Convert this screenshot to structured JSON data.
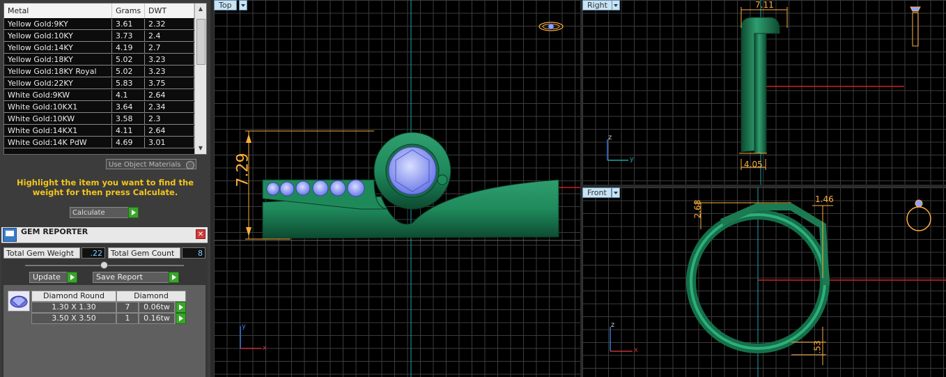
{
  "metal_table": {
    "headers": [
      "Metal",
      "Grams",
      "DWT"
    ],
    "rows": [
      {
        "metal": "Yellow Gold:9KY",
        "grams": "3.61",
        "dwt": "2.32"
      },
      {
        "metal": "Yellow Gold:10KY",
        "grams": "3.73",
        "dwt": "2.4"
      },
      {
        "metal": "Yellow Gold:14KY",
        "grams": "4.19",
        "dwt": "2.7"
      },
      {
        "metal": "Yellow Gold:18KY",
        "grams": "5.02",
        "dwt": "3.23"
      },
      {
        "metal": "Yellow Gold:18KY Royal",
        "grams": "5.02",
        "dwt": "3.23"
      },
      {
        "metal": "Yellow Gold:22KY",
        "grams": "5.83",
        "dwt": "3.75"
      },
      {
        "metal": "White Gold:9KW",
        "grams": "4.1",
        "dwt": "2.64"
      },
      {
        "metal": "White Gold:10KX1",
        "grams": "3.64",
        "dwt": "2.34"
      },
      {
        "metal": "White Gold:10KW",
        "grams": "3.58",
        "dwt": "2.3"
      },
      {
        "metal": "White Gold:14KX1",
        "grams": "4.11",
        "dwt": "2.64"
      },
      {
        "metal": "White Gold:14K PdW",
        "grams": "4.69",
        "dwt": "3.01"
      }
    ],
    "scroll_up_icon": "triangle-up-icon",
    "scroll_down_icon": "triangle-down-icon"
  },
  "use_object_materials": "Use Object Materials",
  "hint": "Highlight the item you want to find the weight for then press Calculate.",
  "calculate_label": "Calculate",
  "gem_reporter": {
    "title": "GEM REPORTER",
    "close_icon": "close-icon",
    "total_weight_label": "Total Gem Weight",
    "total_weight_value": ".22",
    "total_count_label": "Total Gem Count",
    "total_count_value": "8",
    "update_label": "Update",
    "save_report_label": "Save Report",
    "table_headers": [
      "Diamond Round",
      "Diamond"
    ],
    "rows": [
      {
        "size": "1.30 X 1.30",
        "count": "7",
        "weight": "0.06tw"
      },
      {
        "size": "3.50 X 3.50",
        "count": "1",
        "weight": "0.16tw"
      }
    ]
  },
  "viewports": {
    "top": {
      "label": "Top",
      "dimension": "7.29",
      "axis_y": "y",
      "axis_x": "x"
    },
    "right": {
      "label": "Right",
      "dim_top": "7.11",
      "dim_bottom": "4.05",
      "axis_z": "z",
      "axis_y": "y"
    },
    "front": {
      "label": "Front",
      "dim_left": "2.68",
      "dim_right": "1.46",
      "dim_bottom": ".53",
      "axis_z": "z",
      "axis_x": "x"
    }
  },
  "colors": {
    "ring_green": "#1f8a5c",
    "gem_blue": "#8fa3ff",
    "dimension_orange": "#ffb040",
    "hint_yellow": "#f3c61d",
    "grid": "#3c3c3c"
  }
}
